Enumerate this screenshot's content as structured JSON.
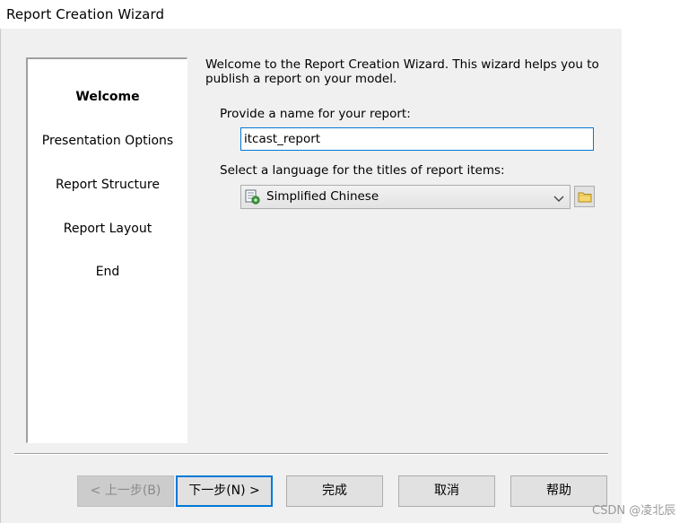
{
  "window": {
    "title": "Report Creation Wizard"
  },
  "steps": [
    {
      "label": "Welcome",
      "active": true
    },
    {
      "label": "Presentation Options",
      "active": false
    },
    {
      "label": "Report Structure",
      "active": false
    },
    {
      "label": "Report Layout",
      "active": false
    },
    {
      "label": "End",
      "active": false
    }
  ],
  "intro_text": "Welcome to the Report Creation Wizard. This wizard helps you to publish a report on your model.",
  "name_field": {
    "label": "Provide a name for your report:",
    "value": "itcast_report"
  },
  "language": {
    "label": "Select a language for the titles of report items:",
    "selected": "Simplified Chinese",
    "icon": "language-settings-icon",
    "browse_icon": "folder-icon"
  },
  "buttons": {
    "back": "< 上一步(B)",
    "next": "下一步(N) >",
    "finish": "完成",
    "cancel": "取消",
    "help": "帮助"
  },
  "watermark": "CSDN @凌北辰",
  "colors": {
    "dialog_bg": "#f0f0f0",
    "focus_accent": "#0078d7",
    "button_bg": "#e1e1e1"
  }
}
